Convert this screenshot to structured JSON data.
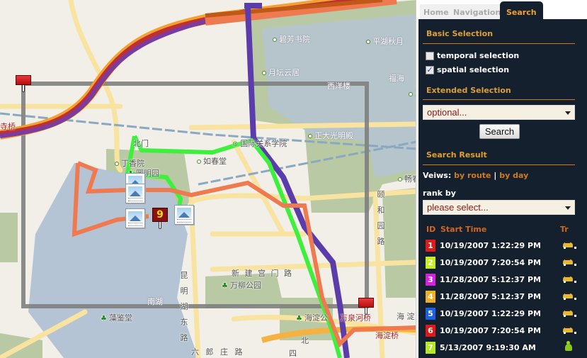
{
  "map": {
    "labels": {
      "l1": "碧芳书院",
      "l2": "平湖秋月",
      "l3": "月坛云居",
      "l4": "福海",
      "l5": "西洋楼",
      "l6": "正大光明殿",
      "l7": "国际关系学院",
      "l8": "丁香院",
      "l9": "如春堂",
      "l10": "畅春",
      "l11": "颐和园路",
      "l12": "新 建 宫 门 路",
      "l13": "万柳公园",
      "l14": "南湖",
      "l15": "昆明湖东路",
      "l16": "藻鉴堂",
      "l17": "海淀公",
      "l18": "万泉河桥",
      "l19": "海淀桥",
      "l20": "海 淀",
      "l21": "六 郎 庄 路",
      "l22": "北",
      "l23": "四",
      "l24": "寺桥",
      "l25": "北门",
      "l26": "圆明园",
      "l27": "湖"
    },
    "poi_marker_number": "9",
    "route_colors": {
      "purple": "#5a3cab",
      "orange": "#f07a50",
      "green": "#3cf03c",
      "dark_orange": "#c05818",
      "red": "#c03030"
    }
  },
  "tabs": [
    {
      "label": "Home",
      "active": false
    },
    {
      "label": "Navigation",
      "active": false
    },
    {
      "label": "Search",
      "active": true
    }
  ],
  "basic_selection": {
    "title": "Basic Selection",
    "temporal": {
      "label": "temporal selection",
      "checked": false
    },
    "spatial": {
      "label": "spatial selection",
      "checked": true
    }
  },
  "extended_selection": {
    "title": "Extended Selection",
    "select_value": "optional...",
    "search_button": "Search"
  },
  "search_result": {
    "title": "Search Result",
    "views_label": "Veiws:",
    "by_route": "by route",
    "separator": "|",
    "by_day": "by day",
    "rank_label": "rank by",
    "rank_select_value": "please select...",
    "columns": {
      "id": "ID",
      "start_time": "Start Time",
      "tr": "Tr"
    },
    "rows": [
      {
        "id": "1",
        "color": "#e31a1a",
        "start_time": "10/19/2007 1:22:29 PM",
        "transport": "car-icon"
      },
      {
        "id": "2",
        "color": "#c8f020",
        "start_time": "10/19/2007 7:20:54 PM",
        "transport": "car-icon"
      },
      {
        "id": "3",
        "color": "#d820e0",
        "start_time": "11/28/2007 5:12:37 PM",
        "transport": "car-icon"
      },
      {
        "id": "4",
        "color": "#f0b020",
        "start_time": "11/28/2007 5:12:37 PM",
        "transport": "car-icon"
      },
      {
        "id": "5",
        "color": "#1a60e8",
        "start_time": "10/19/2007 1:22:29 PM",
        "transport": "car-icon"
      },
      {
        "id": "6",
        "color": "#e01818",
        "start_time": "10/19/2007 7:20:54 PM",
        "transport": "car-icon"
      },
      {
        "id": "7",
        "color": "#b8e820",
        "start_time": "5/13/2007 9:19:30 AM",
        "transport": "walk-icon"
      }
    ]
  }
}
